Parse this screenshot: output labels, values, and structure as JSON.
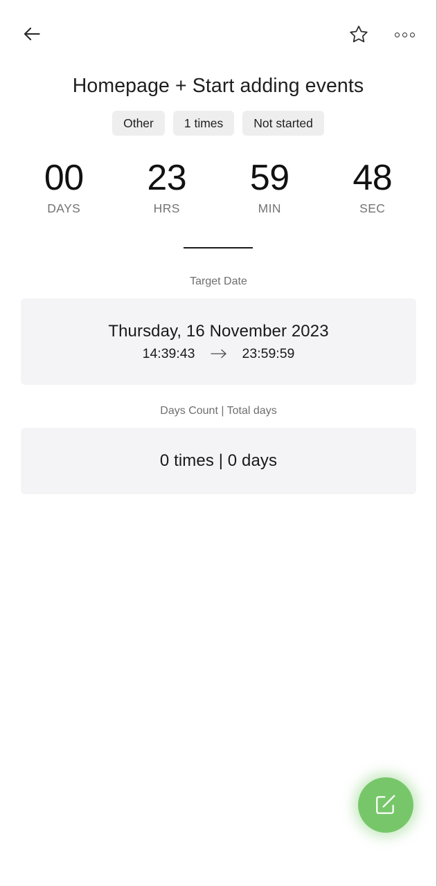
{
  "appbar": {
    "back_icon": "arrow-left-icon",
    "favorite_icon": "star-outline-icon",
    "more_icon": "more-horizontal-icon"
  },
  "title": "Homepage + Start adding events",
  "chips": [
    {
      "label": "Other"
    },
    {
      "label": "1 times"
    },
    {
      "label": "Not started"
    }
  ],
  "countdown": [
    {
      "value": "00",
      "label": "DAYS"
    },
    {
      "value": "23",
      "label": "HRS"
    },
    {
      "value": "59",
      "label": "MIN"
    },
    {
      "value": "48",
      "label": "SEC"
    }
  ],
  "target_section": {
    "label": "Target Date",
    "date": "Thursday, 16 November 2023",
    "start_time": "14:39:43",
    "arrow": "→",
    "end_time": "23:59:59"
  },
  "count_section": {
    "label": "Days Count | Total days",
    "value": "0 times | 0 days"
  },
  "fab": {
    "icon": "edit-square-icon",
    "color": "#77c76a"
  },
  "colors": {
    "background": "#ffffff",
    "card": "#f4f4f6",
    "chip": "#eeeeef",
    "text_primary": "#1f1f1f",
    "text_muted": "#737373",
    "accent": "#77c76a"
  }
}
